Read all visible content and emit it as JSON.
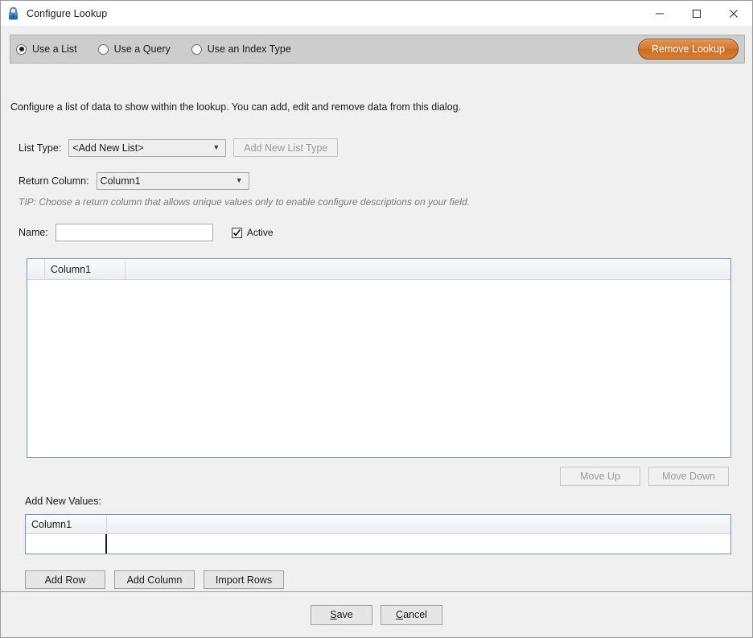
{
  "window": {
    "title": "Configure Lookup",
    "icon": "lock-icon",
    "controls": {
      "minimize": "minimize-icon",
      "maximize": "maximize-icon",
      "close": "close-icon"
    }
  },
  "mode_panel": {
    "options": [
      {
        "label": "Use a List",
        "selected": true
      },
      {
        "label": "Use a Query",
        "selected": false
      },
      {
        "label": "Use an Index Type",
        "selected": false
      }
    ],
    "remove_button": "Remove Lookup",
    "remove_button_color": "#d17f37"
  },
  "description": "Configure a list of data to show within the lookup. You can add, edit and remove data from this dialog.",
  "form": {
    "list_type_label": "List Type:",
    "list_type_value": "<Add New List>",
    "add_new_list_type_button": "Add New List Type",
    "add_new_list_type_enabled": false,
    "return_column_label": "Return Column:",
    "return_column_value": "Column1",
    "tip": "TIP: Choose a return column that allows unique values only to enable configure descriptions on your field.",
    "name_label": "Name:",
    "name_value": "",
    "name_placeholder": "",
    "active_label": "Active",
    "active_checked": true
  },
  "main_grid": {
    "columns": [
      "Column1"
    ],
    "rows": []
  },
  "move_buttons": {
    "move_up": "Move Up",
    "move_up_enabled": false,
    "move_down": "Move Down",
    "move_down_enabled": false
  },
  "add_new_values": {
    "label": "Add New Values:",
    "columns": [
      "Column1"
    ],
    "rows": [
      {
        "Column1": ""
      }
    ]
  },
  "row_actions": {
    "add_row": "Add Row",
    "add_column": "Add Column",
    "import_rows": "Import Rows"
  },
  "footer": {
    "save": "Save",
    "save_mnemonic": "S",
    "save_rest": "ave",
    "cancel": "Cancel",
    "cancel_mnemonic": "C",
    "cancel_rest": "ancel"
  }
}
